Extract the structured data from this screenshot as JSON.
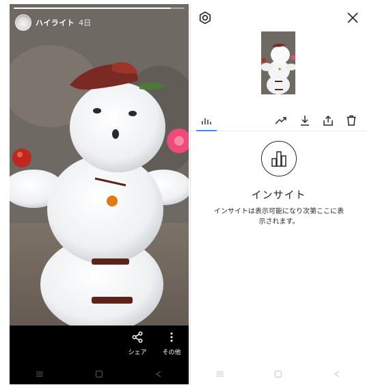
{
  "story": {
    "title": "ハイライト",
    "time": "4日",
    "progress": 0.92,
    "actions": [
      {
        "label": "シェア",
        "icon": "share-icon"
      },
      {
        "label": "その他",
        "icon": "more-vertical-icon"
      }
    ]
  },
  "nav": {
    "icons": [
      "menu-icon",
      "home-square-icon",
      "back-triangle-icon"
    ]
  },
  "insights_panel": {
    "toolbar_icons": [
      "insights-bar-icon",
      "trend-icon",
      "download-icon",
      "share-upload-icon",
      "trash-icon"
    ],
    "heading": "インサイト",
    "description": "インサイトは表示可能になり次第ここに表示されます。"
  },
  "colors": {
    "accent_tab": "#3b8df1",
    "text_primary": "#262626",
    "dark_bg": "#000000"
  }
}
